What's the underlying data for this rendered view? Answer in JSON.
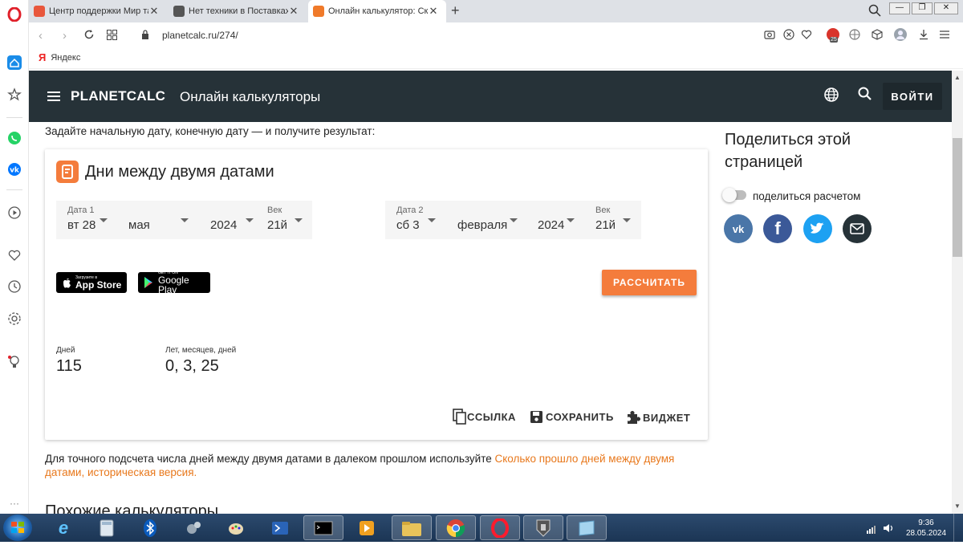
{
  "browser": {
    "tabs": [
      {
        "title": "Центр поддержки Мир та",
        "fav_color": "#e8573c"
      },
      {
        "title": "Нет техники в Поставках и",
        "fav_color": "#555555"
      },
      {
        "title": "Онлайн калькулятор: Ско",
        "fav_color": "#f07a2a"
      }
    ],
    "new_tab": "+",
    "url": "planetcalc.ru/274/",
    "bookmark": "Яндекс",
    "adblock_count": "25"
  },
  "site": {
    "logo": "PLANETCALC",
    "subtitle": "Онлайн калькуляторы",
    "login": "ВОЙТИ"
  },
  "intro": "Задайте начальную дату, конечную дату — и получите результат:",
  "calc": {
    "title": "Дни между двумя датами",
    "date1": {
      "label": "Дата 1",
      "day": "вт 28",
      "month": "мая",
      "year": "2024",
      "century_label": "Век",
      "century": "21й"
    },
    "date2": {
      "label": "Дата 2",
      "day": "сб 3",
      "month": "февраля",
      "year": "2024",
      "century_label": "Век",
      "century": "21й"
    },
    "appstore": {
      "small": "Загрузите в",
      "big": "App Store"
    },
    "googleplay": {
      "small": "GET IT ON",
      "big": "Google Play"
    },
    "calculate": "РАССЧИТАТЬ",
    "result_days_label": "Дней",
    "result_days": "115",
    "result_ymd_label": "Лет, месяцев, дней",
    "result_ymd": "0, 3, 25",
    "link_label": "ССЫЛКА",
    "save_label": "СОХРАНИТЬ",
    "widget_label": "ВИДЖЕТ"
  },
  "note": {
    "text": "Для точного подсчета числа дней между двумя датами в далеком прошлом используйте ",
    "link": "Сколько прошло дней между двумя датами, историческая версия."
  },
  "similar_heading": "Похожие калькуляторы",
  "share": {
    "title": "Поделиться этой страницей",
    "toggle_label": "поделиться расчетом",
    "vk": "vk",
    "fb": "f"
  },
  "colors": {
    "accent": "#f47c3c",
    "header": "#263238",
    "link": "#e8781c"
  },
  "taskbar": {
    "time": "9:36",
    "date": "28.05.2024"
  }
}
